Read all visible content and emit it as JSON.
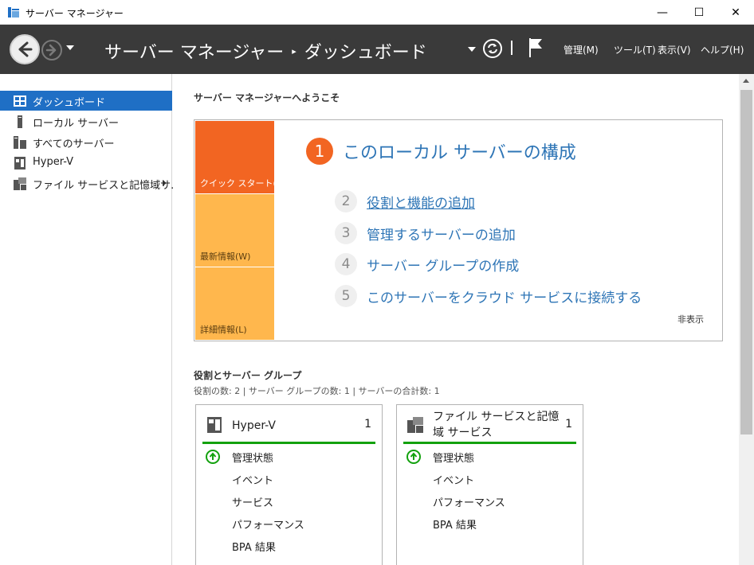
{
  "window": {
    "title": "サーバー マネージャー",
    "minimize": "—",
    "maximize": "☐",
    "close": "✕"
  },
  "header": {
    "breadcrumb_root": "サーバー マネージャー",
    "breadcrumb_sep": "▸",
    "breadcrumb_current": "ダッシュボード",
    "menu": [
      {
        "label": "管理(M)"
      },
      {
        "label": "ツール(T)"
      },
      {
        "label": "表示(V)"
      },
      {
        "label": "ヘルプ(H)"
      }
    ]
  },
  "sidebar": {
    "items": [
      {
        "label": "ダッシュボード",
        "icon": "dashboard-icon",
        "active": true
      },
      {
        "label": "ローカル サーバー",
        "icon": "server-icon"
      },
      {
        "label": "すべてのサーバー",
        "icon": "servers-icon"
      },
      {
        "label": "Hyper-V",
        "icon": "hyperv-icon"
      },
      {
        "label": "ファイル サービスと記憶域サ...",
        "icon": "file-services-icon",
        "has_submenu": true
      }
    ]
  },
  "welcome": {
    "title": "サーバー マネージャーへようこそ",
    "tiles": {
      "quick_start": "クイック スタート(Q)",
      "news": "最新情報(W)",
      "learn_more": "詳細情報(L)"
    },
    "steps": [
      {
        "num": "1",
        "label": "このローカル サーバーの構成"
      },
      {
        "num": "2",
        "label": "役割と機能の追加"
      },
      {
        "num": "3",
        "label": "管理するサーバーの追加"
      },
      {
        "num": "4",
        "label": "サーバー グループの作成"
      },
      {
        "num": "5",
        "label": "このサーバーをクラウド サービスに接続する"
      }
    ],
    "hide": "非表示"
  },
  "groups": {
    "title": "役割とサーバー グループ",
    "summary": "役割の数: 2 | サーバー グループの数: 1 | サーバーの合計数: 1",
    "cards": [
      {
        "title": "Hyper-V",
        "count": "1",
        "rows": [
          "管理状態",
          "イベント",
          "サービス",
          "パフォーマンス",
          "BPA 結果"
        ]
      },
      {
        "title": "ファイル サービスと記憶域 サービス",
        "count": "1",
        "rows": [
          "管理状態",
          "イベント",
          "パフォーマンス",
          "BPA 結果"
        ]
      }
    ]
  },
  "colors": {
    "header_bg": "#3a3a3a",
    "active_item": "#1f6fc5",
    "quick_start": "#f26522",
    "tile_light": "#ffb74d",
    "link": "#2e75b6",
    "status_ok": "#13a10e"
  }
}
